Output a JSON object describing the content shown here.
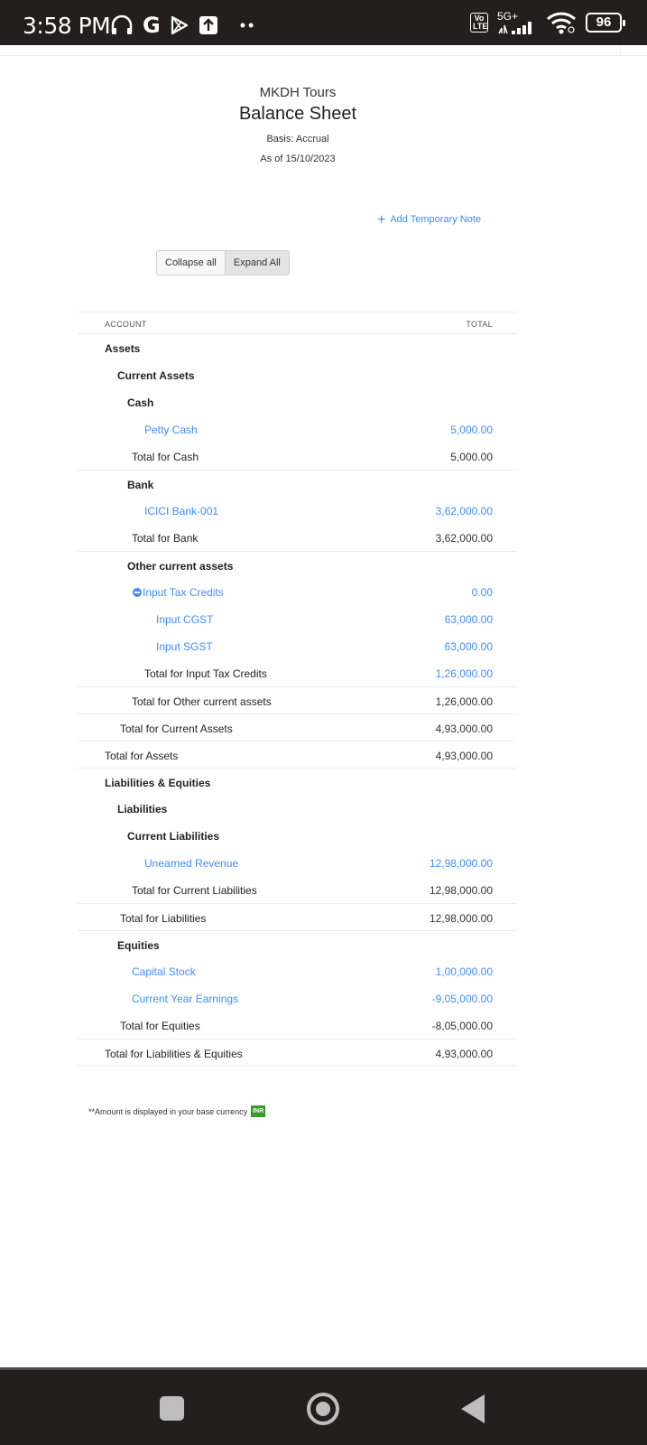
{
  "status_bar": {
    "time": "3:58 PM",
    "left_icons": [
      "headset-icon",
      "google-icon",
      "play-store-icon",
      "upload-icon",
      "more-dots-icon"
    ],
    "volte": "Vo LTE",
    "network": "5G+",
    "battery": "96"
  },
  "report": {
    "org_name": "MKDH Tours",
    "title": "Balance Sheet",
    "basis": "Basis: Accrual",
    "as_of": "As of 15/10/2023"
  },
  "actions": {
    "add_note": "Add Temporary Note",
    "collapse_all": "Collapse all",
    "expand_all": "Expand All"
  },
  "table": {
    "col_account": "ACCOUNT",
    "col_total": "TOTAL",
    "rows": [
      {
        "label": "Assets",
        "value": ""
      },
      {
        "label": "Current Assets",
        "value": ""
      },
      {
        "label": "Cash",
        "value": ""
      },
      {
        "label": "Petty Cash",
        "value": "5,000.00"
      },
      {
        "label": "Total for Cash",
        "value": "5,000.00"
      },
      {
        "label": "Bank",
        "value": ""
      },
      {
        "label": "ICICI Bank-001",
        "value": "3,62,000.00"
      },
      {
        "label": "Total for Bank",
        "value": "3,62,000.00"
      },
      {
        "label": "Other current assets",
        "value": ""
      },
      {
        "label": "Input Tax Credits",
        "value": "0.00"
      },
      {
        "label": "Input CGST",
        "value": "63,000.00"
      },
      {
        "label": "Input SGST",
        "value": "63,000.00"
      },
      {
        "label": "Total for Input Tax Credits",
        "value": "1,26,000.00"
      },
      {
        "label": "Total for Other current assets",
        "value": "1,26,000.00"
      },
      {
        "label": "Total for Current Assets",
        "value": "4,93,000.00"
      },
      {
        "label": "Total for Assets",
        "value": "4,93,000.00"
      },
      {
        "label": "Liabilities & Equities",
        "value": ""
      },
      {
        "label": "Liabilities",
        "value": ""
      },
      {
        "label": "Current Liabilities",
        "value": ""
      },
      {
        "label": "Unearned Revenue",
        "value": "12,98,000.00"
      },
      {
        "label": "Total for Current Liabilities",
        "value": "12,98,000.00"
      },
      {
        "label": "Total for Liabilities",
        "value": "12,98,000.00"
      },
      {
        "label": "Equities",
        "value": ""
      },
      {
        "label": "Capital Stock",
        "value": "1,00,000.00"
      },
      {
        "label": "Current Year Earnings",
        "value": "-9,05,000.00"
      },
      {
        "label": "Total for Equities",
        "value": "-8,05,000.00"
      },
      {
        "label": "Total for Liabilities & Equities",
        "value": "4,93,000.00"
      }
    ]
  },
  "footnote": {
    "text": "**Amount is displayed in your base currency",
    "currency": "INR"
  },
  "colors": {
    "link": "#408dfb",
    "status_bar": "#231f1e",
    "currency_badge": "#3a9a2c"
  }
}
